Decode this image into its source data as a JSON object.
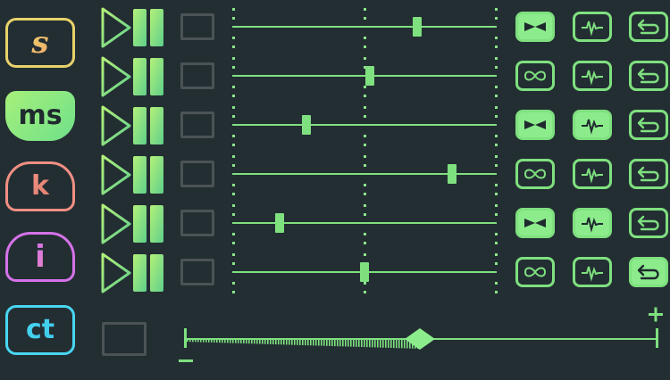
{
  "modes": [
    {
      "label": "s",
      "name": "s",
      "color_from": "#e8d26a",
      "color_to": "#f3a86a",
      "filled": false
    },
    {
      "label": "ms",
      "name": "ms",
      "color_from": "#a6f07a",
      "color_to": "#6fe08a",
      "filled": true
    },
    {
      "label": "k",
      "name": "k",
      "color_from": "#f08f82",
      "color_to": "#e0806f",
      "filled": false
    },
    {
      "label": "i",
      "name": "i",
      "color_from": "#d572e8",
      "color_to": "#e784c4",
      "filled": false
    },
    {
      "label": "ct",
      "name": "ct",
      "color_from": "#48d6f2",
      "color_to": "#3fc8ea",
      "filled": false
    }
  ],
  "tracks": [
    {
      "level": 0.7,
      "loop_on": true,
      "pulse_on": false,
      "undo_on": false
    },
    {
      "level": 0.52,
      "loop_on": false,
      "pulse_on": false,
      "undo_on": false
    },
    {
      "level": 0.28,
      "loop_on": true,
      "pulse_on": true,
      "undo_on": false
    },
    {
      "level": 0.83,
      "loop_on": false,
      "pulse_on": false,
      "undo_on": false
    },
    {
      "level": 0.18,
      "loop_on": true,
      "pulse_on": true,
      "undo_on": false
    },
    {
      "level": 0.5,
      "loop_on": false,
      "pulse_on": false,
      "undo_on": true
    }
  ],
  "master": {
    "level": 0.5,
    "minus_icon": "minus-icon",
    "plus_icon": "plus-icon"
  },
  "colors": {
    "accent": "#7fe07f",
    "accent_light": "#8cec8c",
    "background": "#232e33",
    "disabled": "#4b5357"
  },
  "icons": {
    "play": "play-icon",
    "pause": "pause-icon",
    "loop": "infinity-icon",
    "pulse": "waveform-icon",
    "undo": "return-arrow-icon"
  }
}
